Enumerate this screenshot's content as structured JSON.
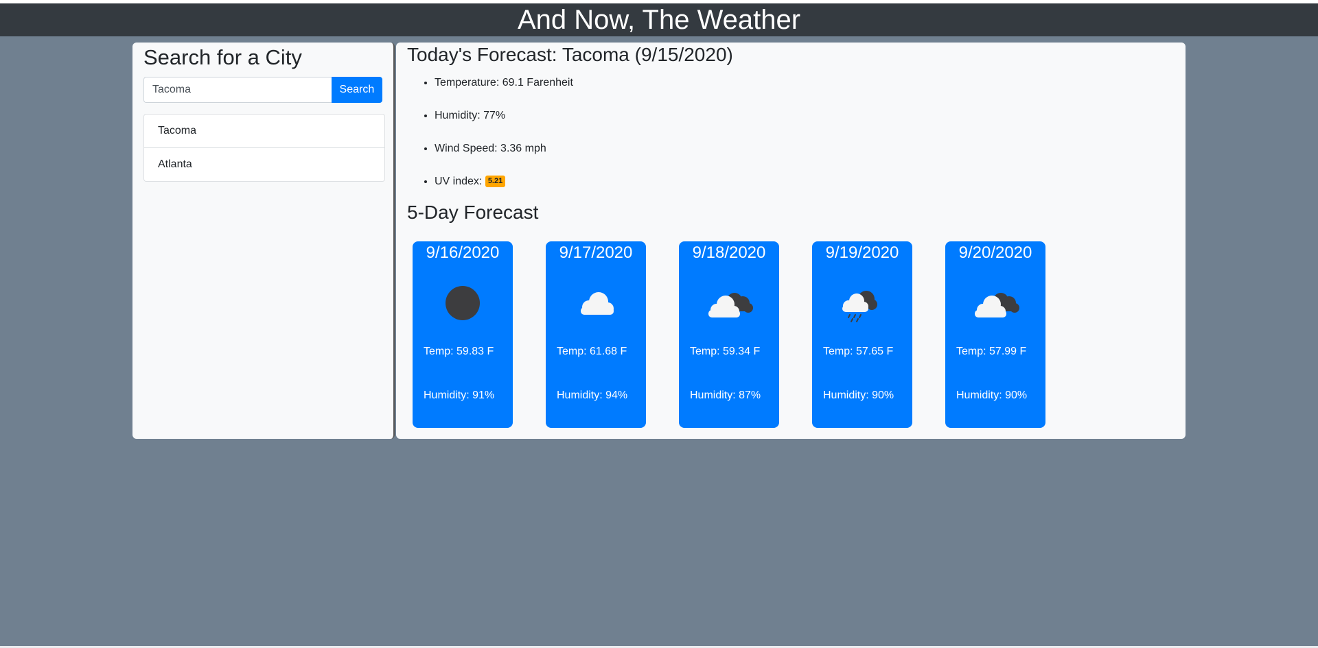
{
  "header": {
    "title": "And Now, The Weather"
  },
  "search": {
    "title": "Search for a City",
    "input_value": "Tacoma",
    "button_label": "Search",
    "history": [
      {
        "label": "Tacoma"
      },
      {
        "label": "Atlanta"
      }
    ]
  },
  "today": {
    "title": "Today's Forecast: Tacoma (9/15/2020)",
    "temperature": "Temperature: 69.1 Farenheit",
    "humidity": "Humidity: 77%",
    "wind": "Wind Speed: 3.36 mph",
    "uv_label": "UV index: ",
    "uv_value": "5.21",
    "uv_color": "#ffa500"
  },
  "forecast": {
    "title": "5-Day Forecast",
    "accent": "#007bff",
    "days": [
      {
        "date": "9/16/2020",
        "icon": "clear-sky-icon",
        "temp": "Temp: 59.83 F",
        "humidity": "Humidity: 91%"
      },
      {
        "date": "9/17/2020",
        "icon": "cloud-icon",
        "temp": "Temp: 61.68 F",
        "humidity": "Humidity: 94%"
      },
      {
        "date": "9/18/2020",
        "icon": "broken-clouds-icon",
        "temp": "Temp: 59.34 F",
        "humidity": "Humidity: 87%"
      },
      {
        "date": "9/19/2020",
        "icon": "rain-cloud-icon",
        "temp": "Temp: 57.65 F",
        "humidity": "Humidity: 90%"
      },
      {
        "date": "9/20/2020",
        "icon": "broken-clouds-icon",
        "temp": "Temp: 57.99 F",
        "humidity": "Humidity: 90%"
      }
    ]
  }
}
